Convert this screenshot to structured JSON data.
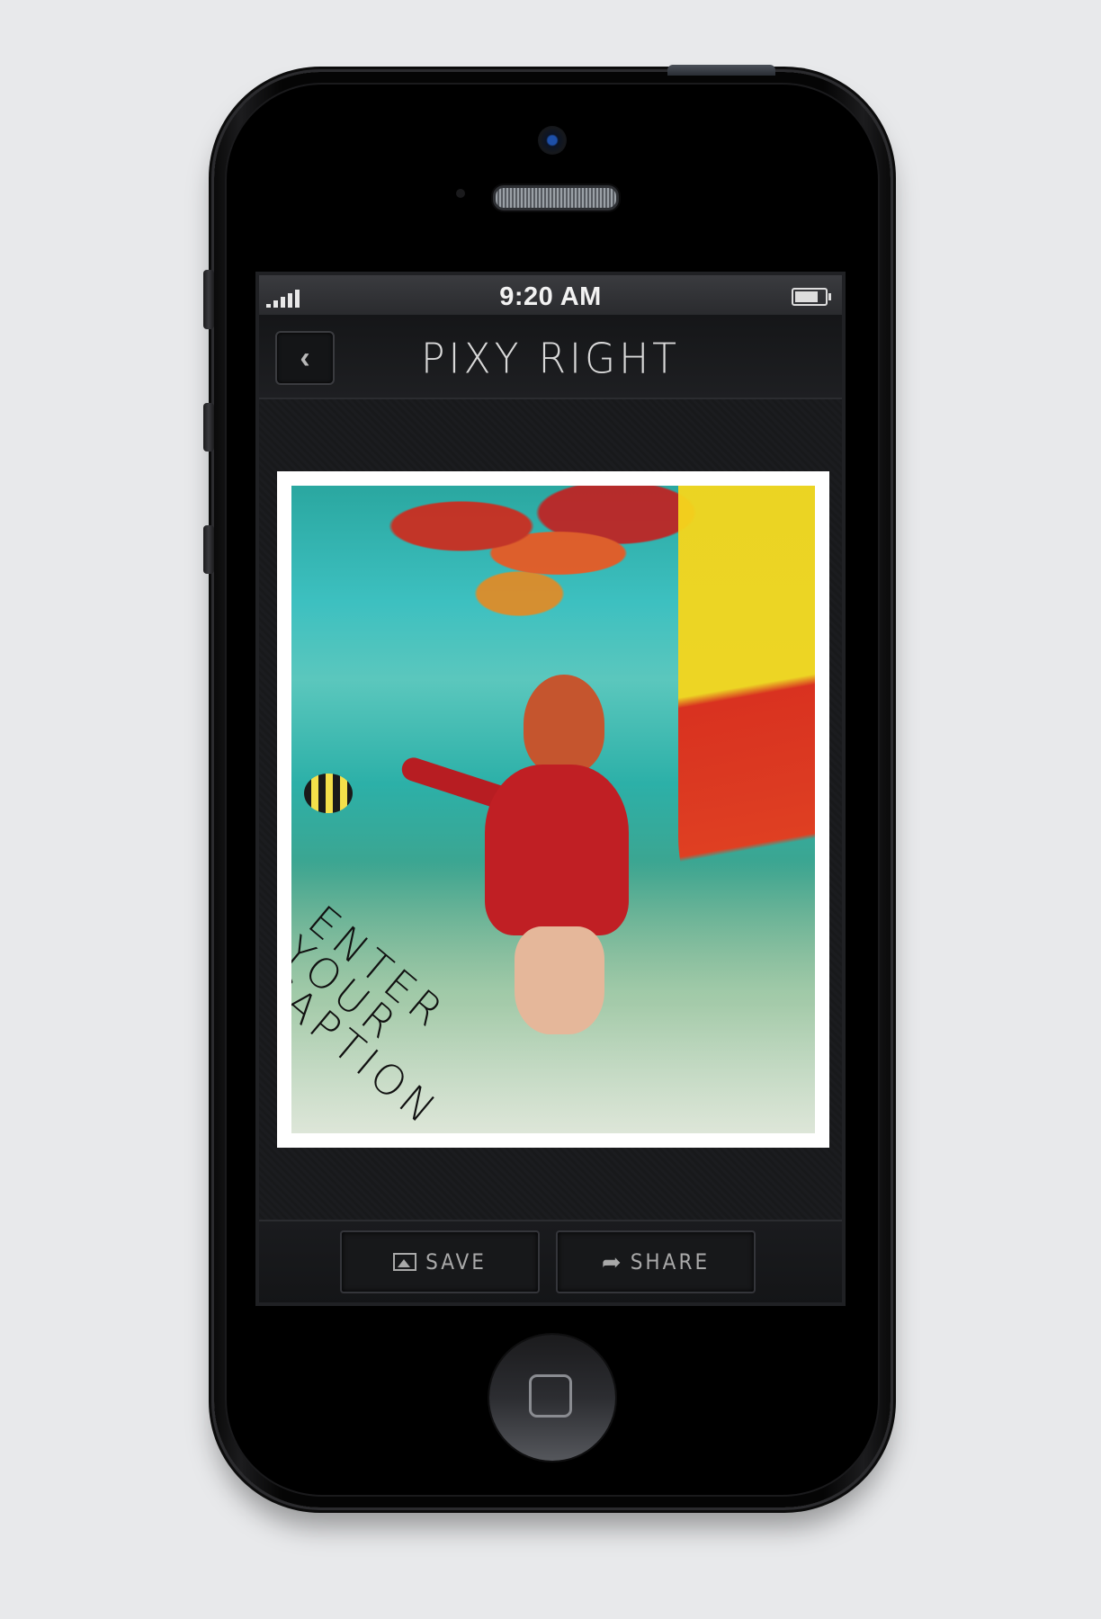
{
  "status_bar": {
    "time": "9:20 AM",
    "signal_bars": 5,
    "battery_level": 0.9
  },
  "nav": {
    "back_icon": "chevron-left-icon",
    "back_glyph": "‹",
    "title": "PIXY RIGHT"
  },
  "photo": {
    "caption_lines": [
      "ENTER",
      "YOUR",
      "CAPTION"
    ]
  },
  "toolbar": {
    "save_label": "SAVE",
    "save_icon": "image-icon",
    "share_label": "SHARE",
    "share_icon": "share-arrow-icon",
    "share_glyph": "➦"
  },
  "colors": {
    "background": "#e8e9eb",
    "screen": "#16171a",
    "status_text": "#f2f2f2",
    "button_text": "#a9a9a9"
  }
}
